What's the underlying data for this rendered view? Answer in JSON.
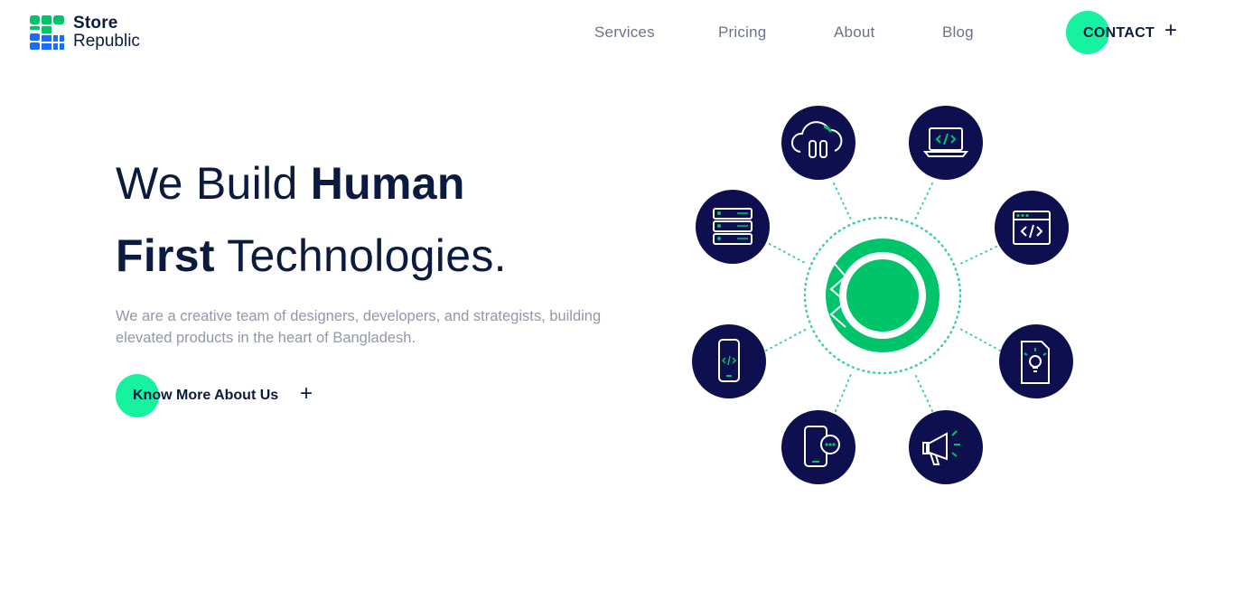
{
  "brand": {
    "line1": "Store",
    "line2": "Republic",
    "colors": {
      "navy": "#0b1a3f",
      "green": "#00c46a",
      "mint": "#17f2a0",
      "blue": "#1a6cff"
    }
  },
  "nav": {
    "items": [
      {
        "label": "Services"
      },
      {
        "label": "Pricing"
      },
      {
        "label": "About"
      },
      {
        "label": "Blog"
      }
    ],
    "contact_label": "CONTACT",
    "plus_glyph": "+"
  },
  "hero": {
    "title_part1": "We Build ",
    "title_bold1": "Human",
    "title_bold2": "First",
    "title_part2": " Technologies.",
    "description": "We are a creative team of designers, developers, and strategists, building elevated products in the heart of Bangladesh.",
    "cta_label": "Know More About Us",
    "cta_plus": "+"
  },
  "illustration": {
    "icons": [
      "cloud-icon",
      "laptop-code-icon",
      "server-icon",
      "browser-code-icon",
      "mobile-code-icon",
      "document-idea-icon",
      "mobile-chat-icon",
      "megaphone-icon"
    ]
  }
}
